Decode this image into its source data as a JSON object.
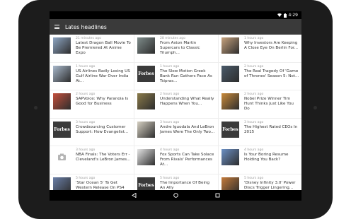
{
  "status": {
    "time": "4:29"
  },
  "toolbar": {
    "title": "Lates headlines"
  },
  "cards": [
    {
      "time": "21 minutes ago",
      "headline": "Latest Dragon Ball Movie To Be Premiered At Anime Expo",
      "thumb": "dragonball-image",
      "color": "#8fa7c4"
    },
    {
      "time": "28 minutes ago",
      "headline": "From Aston Martin Supercars to Classic Triumph...",
      "thumb": "car-image",
      "color": "#7e8c8a"
    },
    {
      "time": "1 hours ago",
      "headline": "Why Investors Are Keeping A Close Eye On Berlin For...",
      "thumb": "portrait-image",
      "color": "#c6a27d"
    },
    {
      "time": "1 hours ago",
      "headline": "US Airlines Badly Losing US Gulf Airline War Over India At...",
      "thumb": "airplane-image",
      "color": "#a9b9cc"
    },
    {
      "time": "1 hours ago",
      "headline": "The Slow Motion Greek Bank Run Gathers Pace As Tsipras...",
      "thumb": "forbes-logo",
      "color": "#3a3a3a"
    },
    {
      "time": "2 hours ago",
      "headline": "The Real Tragedy Of 'Game of Thrones' Season 5: Not...",
      "thumb": "thrones-image",
      "color": "#4a5a6a"
    },
    {
      "time": "2 hours ago",
      "headline": "SAPVoice: Why Paranoia Is Good for Business",
      "thumb": "hazard-image",
      "color": "#c44f3c"
    },
    {
      "time": "2 hours ago",
      "headline": "Understanding What Really Happens When You...",
      "thumb": "painting-image",
      "color": "#8a7a4a"
    },
    {
      "time": "2 hours ago",
      "headline": "Nobel Prize Winner Tim Hunt Thinks Just Like You Do",
      "thumb": "art-image",
      "color": "#c98a3a"
    },
    {
      "time": "3 hours ago",
      "headline": "Crowdsourcing Customer Support: How Evangelist...",
      "thumb": "forbes-logo",
      "color": "#3a3a3a"
    },
    {
      "time": "3 hours ago",
      "headline": "Andre Iguodala And LeBron James Were The Only Two...",
      "thumb": "document-image",
      "color": "#d6d0c2"
    },
    {
      "time": "3 hours ago",
      "headline": "The Highest Rated CEOs In 2015",
      "thumb": "forbes-logo",
      "color": "#3a3a3a"
    },
    {
      "time": "3 hours ago",
      "headline": "NBA Finals: The Voters Err - Cleveland's LeBron James...",
      "thumb": "camera-placeholder",
      "color": "#ffffff"
    },
    {
      "time": "4 hours ago",
      "headline": "Fox Sports Can Take Solace From Rivals' Performances At...",
      "thumb": "table-image",
      "color": "#e4e4e4"
    },
    {
      "time": "4 hours ago",
      "headline": "Is Your Boring Resume Holding You Back?",
      "thumb": "globe-image",
      "color": "#6a8fc4"
    },
    {
      "time": "5 hours ago",
      "headline": "'Star Ocean 5' To Get Western Release On PS4 Next Year",
      "thumb": "starocean-image",
      "color": "#6a7fa8"
    },
    {
      "time": "5 hours ago",
      "headline": "The Importance Of Being An Ally",
      "thumb": "forbes-logo",
      "color": "#3a3a3a"
    },
    {
      "time": "5 hours ago",
      "headline": "'Disney Infinity 3.0' Power Discs Trigger Lingering...",
      "thumb": "disney-image",
      "color": "#c47a3a"
    }
  ],
  "logo": {
    "forbes": "Forbes"
  },
  "icons": {
    "menu": "hamburger-icon",
    "back": "back-icon",
    "home": "home-icon",
    "recents": "recents-icon",
    "wifi": "wifi-icon",
    "battery": "battery-icon"
  }
}
